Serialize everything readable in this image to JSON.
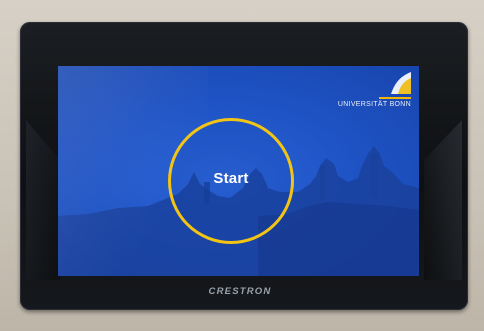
{
  "screen": {
    "start_label": "Start",
    "logo_text": "UNIVERSITÄT BONN",
    "ring_color": "#f2c416",
    "background_color": "#1f54c6"
  },
  "device": {
    "brand_label": "CRESTRON"
  }
}
